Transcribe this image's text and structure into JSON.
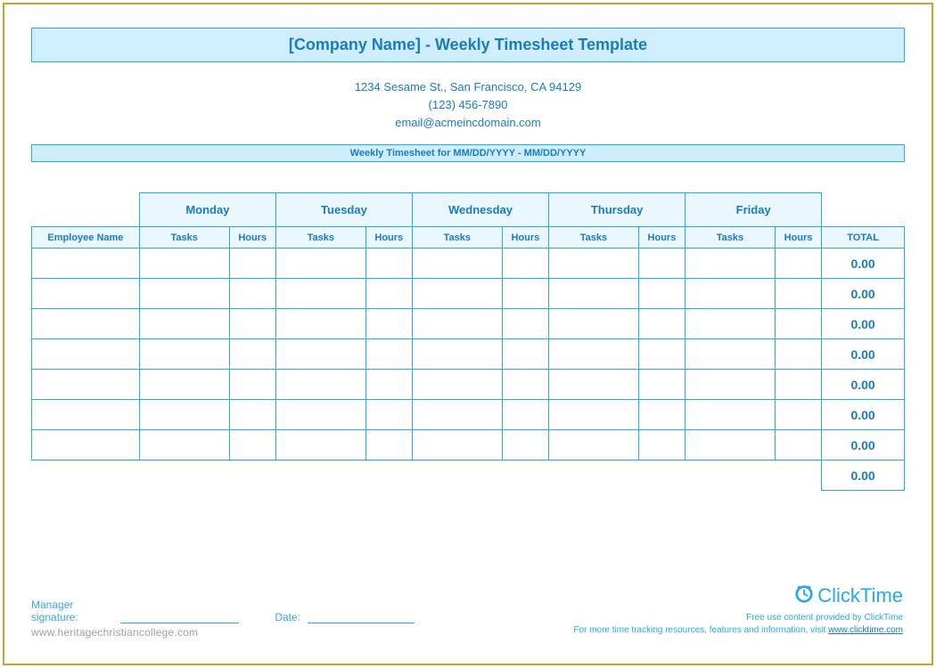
{
  "title": "[Company Name] - Weekly Timesheet Template",
  "company": {
    "address": "1234 Sesame St.,  San Francisco, CA 94129",
    "phone": "(123) 456-7890",
    "email": "email@acmeincdomain.com"
  },
  "period_label": "Weekly Timesheet for MM/DD/YYYY - MM/DD/YYYY",
  "table": {
    "employee_col": "Employee Name",
    "days": [
      "Monday",
      "Tuesday",
      "Wednesday",
      "Thursday",
      "Friday"
    ],
    "sub_cols": [
      "Tasks",
      "Hours"
    ],
    "total_col": "TOTAL",
    "row_count": 7,
    "row_total": "0.00",
    "grand_total": "0.00"
  },
  "signature": {
    "manager_label": "Manager signature:",
    "date_label": "Date:"
  },
  "watermark": "www.heritagechristiancollege.com",
  "brand": {
    "name": "ClickTime",
    "line1": "Free use content provided by ClickTime",
    "line2_pre": "For more time tracking resources, features and information, visit ",
    "line2_link": "www.clicktime.com"
  }
}
